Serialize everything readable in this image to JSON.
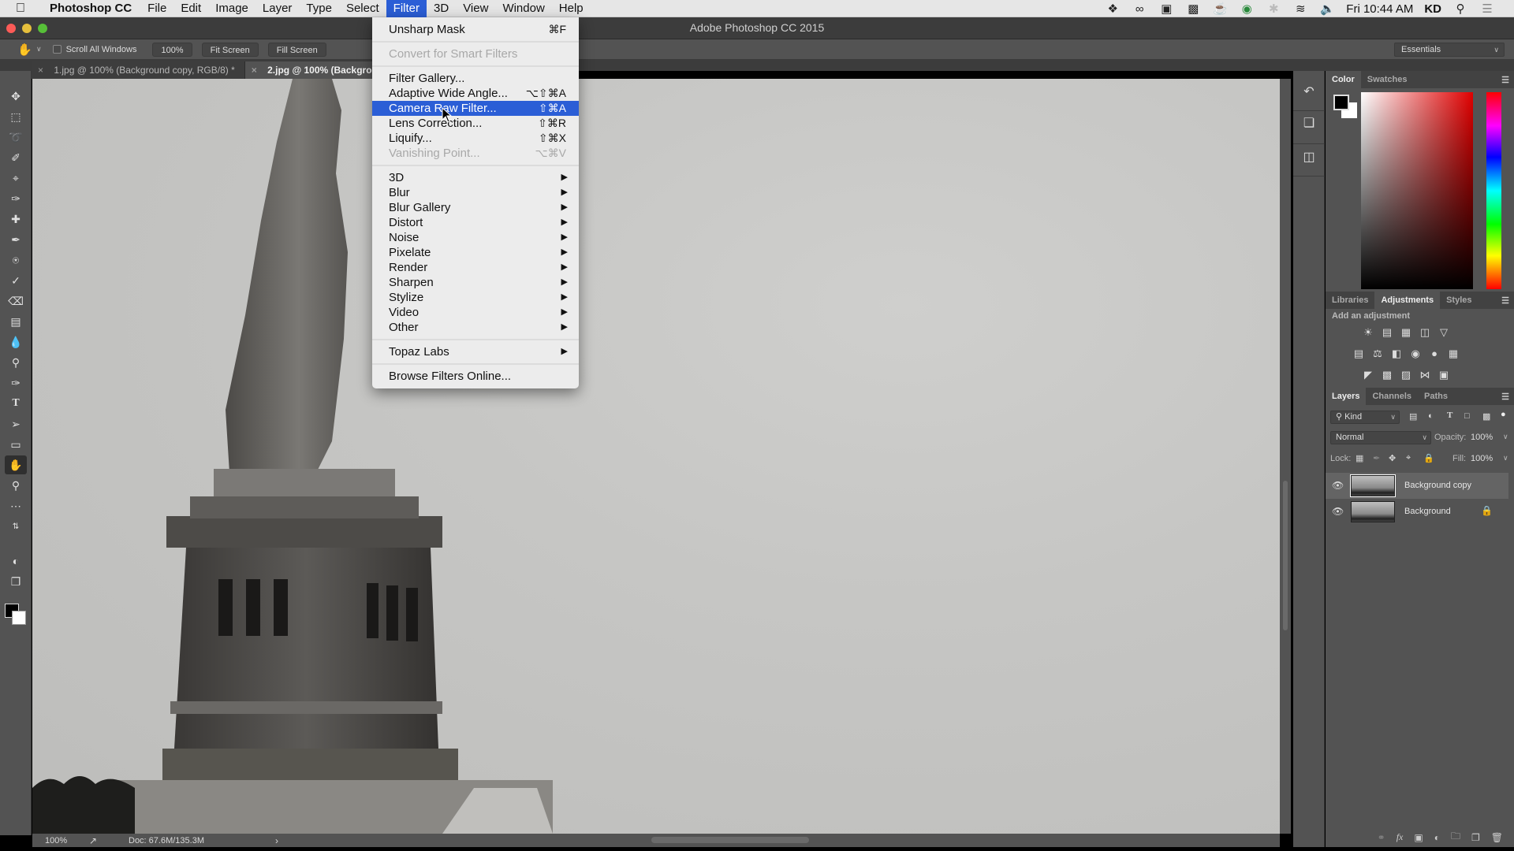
{
  "menubar": {
    "app_name": "Photoshop CC",
    "items": [
      "File",
      "Edit",
      "Image",
      "Layer",
      "Type",
      "Select",
      "Filter",
      "3D",
      "View",
      "Window",
      "Help"
    ],
    "active_item": "Filter",
    "status_icons": [
      "dropbox-paused-icon",
      "creative-cloud-icon",
      "screen-record-icon",
      "time-machine-icon",
      "caffeine-icon",
      "sync-icon",
      "bluetooth-icon",
      "wifi-icon",
      "volume-icon"
    ],
    "clock": "Fri 10:44 AM",
    "user": "KD"
  },
  "window": {
    "title": "Adobe Photoshop CC 2015"
  },
  "options_bar": {
    "scroll_all_windows_label": "Scroll All Windows",
    "scroll_all_windows_checked": false,
    "zoom_button": "100%",
    "fit_screen_button": "Fit Screen",
    "fill_screen_button": "Fill Screen",
    "workspace": "Essentials"
  },
  "document_tabs": [
    {
      "label": "1.jpg @ 100% (Background copy, RGB/8) *",
      "active": false
    },
    {
      "label": "2.jpg @ 100% (Backgrou",
      "active": true
    }
  ],
  "filter_menu": {
    "items": [
      {
        "label": "Unsharp Mask",
        "shortcut": "⌘F",
        "disabled": false
      },
      {
        "separator": true
      },
      {
        "label": "Convert for Smart Filters",
        "shortcut": "",
        "disabled": true
      },
      {
        "separator": true
      },
      {
        "label": "Filter Gallery...",
        "shortcut": "",
        "disabled": false
      },
      {
        "label": "Adaptive Wide Angle...",
        "shortcut": "⌥⇧⌘A",
        "disabled": false
      },
      {
        "label": "Camera Raw Filter...",
        "shortcut": "⇧⌘A",
        "disabled": false,
        "highlighted": true
      },
      {
        "label": "Lens Correction...",
        "shortcut": "⇧⌘R",
        "disabled": false
      },
      {
        "label": "Liquify...",
        "shortcut": "⇧⌘X",
        "disabled": false
      },
      {
        "label": "Vanishing Point...",
        "shortcut": "⌥⌘V",
        "disabled": true
      },
      {
        "separator": true
      },
      {
        "label": "3D",
        "submenu": true
      },
      {
        "label": "Blur",
        "submenu": true
      },
      {
        "label": "Blur Gallery",
        "submenu": true
      },
      {
        "label": "Distort",
        "submenu": true
      },
      {
        "label": "Noise",
        "submenu": true
      },
      {
        "label": "Pixelate",
        "submenu": true
      },
      {
        "label": "Render",
        "submenu": true
      },
      {
        "label": "Sharpen",
        "submenu": true
      },
      {
        "label": "Stylize",
        "submenu": true
      },
      {
        "label": "Video",
        "submenu": true
      },
      {
        "label": "Other",
        "submenu": true
      },
      {
        "separator": true
      },
      {
        "label": "Topaz Labs",
        "submenu": true
      },
      {
        "separator": true
      },
      {
        "label": "Browse Filters Online...",
        "shortcut": "",
        "disabled": false
      }
    ]
  },
  "tools": [
    "move-tool",
    "marquee-tool",
    "lasso-tool",
    "quick-selection-tool",
    "crop-tool",
    "eyedropper-tool",
    "healing-brush-tool",
    "brush-tool",
    "clone-stamp-tool",
    "history-brush-tool",
    "eraser-tool",
    "gradient-tool",
    "blur-tool",
    "dodge-tool",
    "pen-tool",
    "type-tool",
    "path-selection-tool",
    "rectangle-tool",
    "hand-tool",
    "zoom-tool",
    "more-tools"
  ],
  "active_tool": "hand-tool",
  "status_bar": {
    "zoom": "100%",
    "doc_size": "Doc: 67.6M/135.3M"
  },
  "color_panel": {
    "tabs": [
      "Color",
      "Swatches"
    ],
    "active_tab": "Color",
    "foreground": "#000000",
    "background": "#ffffff",
    "hue_color": "#e00000"
  },
  "adjustments_panel": {
    "tabs": [
      "Libraries",
      "Adjustments",
      "Styles"
    ],
    "active_tab": "Adjustments",
    "heading": "Add an adjustment",
    "rows": [
      [
        "brightness-contrast-icon",
        "levels-icon",
        "curves-icon",
        "exposure-icon",
        "vibrance-icon"
      ],
      [
        "hue-saturation-icon",
        "color-balance-icon",
        "black-white-icon",
        "photo-filter-icon",
        "channel-mixer-icon",
        "color-lookup-icon"
      ],
      [
        "invert-icon",
        "posterize-icon",
        "threshold-icon",
        "selective-color-icon",
        "gradient-map-icon"
      ]
    ]
  },
  "layers_panel": {
    "tabs": [
      "Layers",
      "Channels",
      "Paths"
    ],
    "active_tab": "Layers",
    "filter_kind": "Kind",
    "blend_mode": "Normal",
    "opacity_label": "Opacity:",
    "opacity": "100%",
    "lock_label": "Lock:",
    "fill_label": "Fill:",
    "fill": "100%",
    "layers": [
      {
        "name": "Background copy",
        "visible": true,
        "selected": true,
        "locked": false,
        "smart_object": true
      },
      {
        "name": "Background",
        "visible": true,
        "selected": false,
        "locked": true,
        "smart_object": false
      }
    ],
    "footer_icons": [
      "link-layers-icon",
      "fx-icon",
      "add-mask-icon",
      "adjustment-layer-icon",
      "group-folder-icon",
      "new-layer-icon",
      "trash-icon"
    ]
  }
}
